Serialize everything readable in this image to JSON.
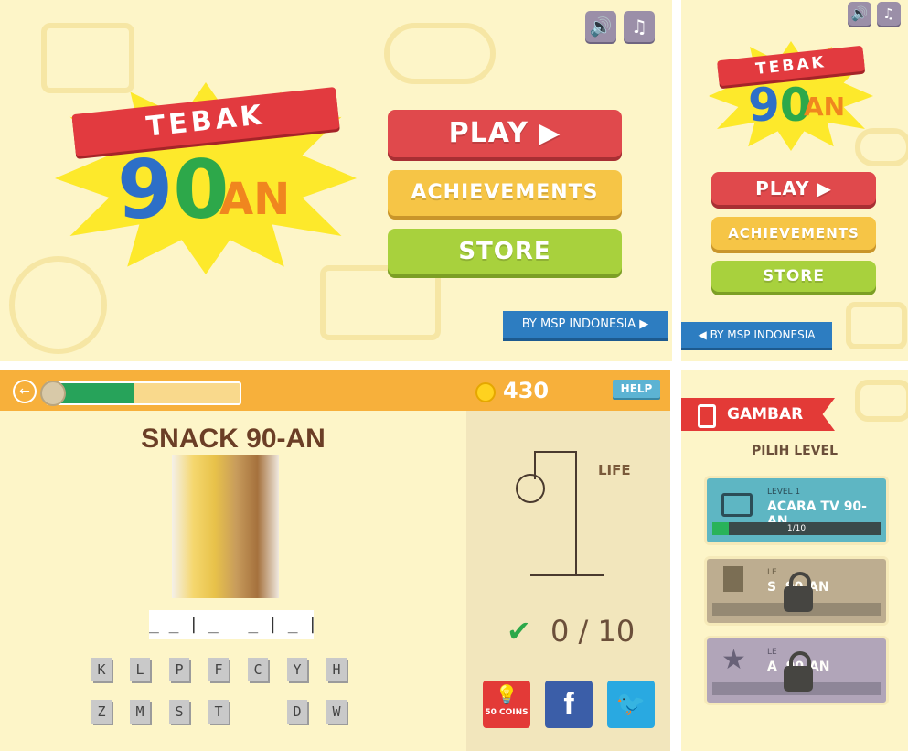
{
  "menu_large": {
    "logo_ribbon": "TEBAK",
    "logo_number": "90",
    "logo_suffix": "AN",
    "buttons": [
      "PLAY ▶",
      "ACHIEVEMENTS",
      "STORE"
    ],
    "credit": "BY MSP INDONESIA ▶",
    "sound_icon": "🔊",
    "music_icon": "♫"
  },
  "menu_small": {
    "logo_ribbon": "TEBAK",
    "logo_number": "90",
    "logo_suffix": "AN",
    "buttons": [
      "PLAY ▶",
      "ACHIEVEMENTS",
      "STORE"
    ],
    "credit": "◀ BY MSP INDONESIA",
    "sound_icon": "🔊",
    "music_icon": "♫"
  },
  "game": {
    "back_icon": "←",
    "progress_fraction": 0.45,
    "coins": "430",
    "help": "HELP",
    "category": "SNACK 90-AN",
    "answer_pattern": "_ _ | _   _ | _ |",
    "letters_row1": [
      "K",
      "L",
      "P",
      "F",
      "C",
      "Y",
      "H"
    ],
    "letters_row2": [
      "Z",
      "M",
      "S",
      "T",
      "",
      "D",
      "W"
    ],
    "life_label": "LIFE",
    "check": "✔",
    "score": "0 / 10",
    "hint_label": "50 COINS",
    "facebook": "f",
    "twitter": "🐦"
  },
  "levels": {
    "header": "GAMBAR",
    "subtitle": "PILIH LEVEL",
    "cards": [
      {
        "level": "LEVEL 1",
        "title": "ACARA TV 90-AN",
        "progress": "1/10",
        "color": "#5eb6c3",
        "locked": false
      },
      {
        "level": "LE",
        "title": "S  90-AN",
        "progress": "",
        "color": "#b7a68a",
        "locked": true
      },
      {
        "level": "LE",
        "title": "A  90-AN",
        "progress": "",
        "color": "#a99db8",
        "locked": true
      }
    ]
  }
}
